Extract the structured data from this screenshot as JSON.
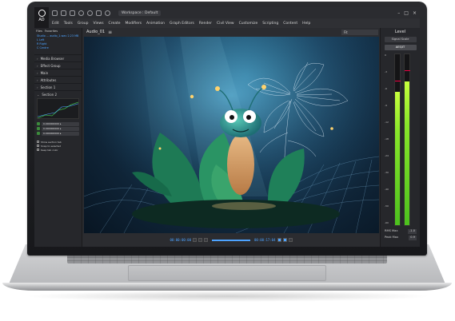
{
  "app": {
    "logo_text": "AD",
    "workspace": "Workspace : Default"
  },
  "menu": [
    "Edit",
    "Tools",
    "Group",
    "Views",
    "Create",
    "Modifiers",
    "Animation",
    "Graph Editors",
    "Render",
    "Civil View",
    "Customize",
    "Scripting",
    "Content",
    "Help"
  ],
  "left_panel": {
    "tabs": [
      "Files",
      "Favorites"
    ],
    "tree": [
      "Studio ... audio_1.wav    2.23 MB",
      "L Left",
      "R Right",
      "C Centre"
    ],
    "sections": [
      "Media Browser",
      "Effect Group",
      "Main",
      "Attributes",
      "Section 1",
      "Section 2"
    ],
    "params": [
      "0.000000000 ▸",
      "0.000000000 ▸",
      "0.000000000 ▸"
    ],
    "checks": [
      "Show section tab",
      "Snap to selected",
      "Keep tab color"
    ]
  },
  "viewport": {
    "title": "Audio_01",
    "search": "Fit"
  },
  "timeline": {
    "timecode_left": "00:00:00:00",
    "timecode_right": "00:00:17:04"
  },
  "right_panel": {
    "title": "Level",
    "button1": "Signal Scale",
    "button2": "AES/IT",
    "scale": [
      "0",
      "-3",
      "-6",
      "-9",
      "-12",
      "-18",
      "-24",
      "-30",
      "-40",
      "-50",
      "-60"
    ],
    "meters": [
      {
        "name": "L",
        "level": 0.78,
        "peak": 0.84
      },
      {
        "name": "R",
        "level": 0.84,
        "peak": 0.9
      }
    ],
    "rms_label": "RMS Max",
    "rms_value": "-1.0",
    "peak_label": "Peak Max",
    "peak_value": "0.9"
  },
  "colors": {
    "accent": "#4da3ff",
    "meter_green": "#6fd62a",
    "panel": "#26272b"
  }
}
